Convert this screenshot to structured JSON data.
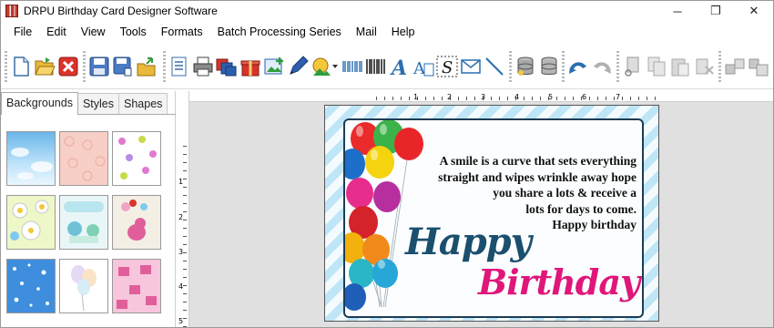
{
  "window": {
    "title": "DRPU Birthday Card Designer Software",
    "controls": {
      "minimize": "─",
      "maximize": "❐",
      "close": "✕"
    }
  },
  "menu": [
    "File",
    "Edit",
    "View",
    "Tools",
    "Formats",
    "Batch Processing Series",
    "Mail",
    "Help"
  ],
  "toolbar": {
    "icons": [
      "new-icon",
      "open-icon",
      "close-icon",
      "save-icon",
      "save-as-icon",
      "export-icon",
      "properties-icon",
      "print-icon",
      "print-multiple-icon",
      "gift-icon",
      "add-image-icon",
      "pen-icon",
      "picture-icon",
      "barcode-linear-icon",
      "barcode-icon",
      "text-icon",
      "text-box-icon",
      "signature-icon",
      "mail-icon",
      "line-icon",
      "database-icon",
      "database-alt-icon",
      "undo-icon",
      "redo-icon",
      "cut-icon",
      "copy-icon",
      "paste-icon",
      "delete-icon",
      "bring-front-icon",
      "send-back-icon"
    ]
  },
  "left_panel": {
    "tabs": [
      "Backgrounds",
      "Styles",
      "Shapes"
    ],
    "active_tab": "Backgrounds"
  },
  "rulers": {
    "top": [
      "1",
      "2",
      "3",
      "4",
      "5",
      "6",
      "7"
    ],
    "left": [
      "1",
      "2",
      "3",
      "4",
      "5"
    ]
  },
  "card": {
    "message": [
      "A smile is a curve that sets everything",
      "straight and wipes wrinkle away hope",
      "you share a lots & receive a",
      "lots for days to come.",
      "Happy birthday"
    ],
    "headline_1": "Happy",
    "headline_2": "Birthday",
    "colors": {
      "headline_1": "#1a4f6e",
      "headline_2": "#e0167a",
      "stripe": "#bfe6f7"
    }
  }
}
